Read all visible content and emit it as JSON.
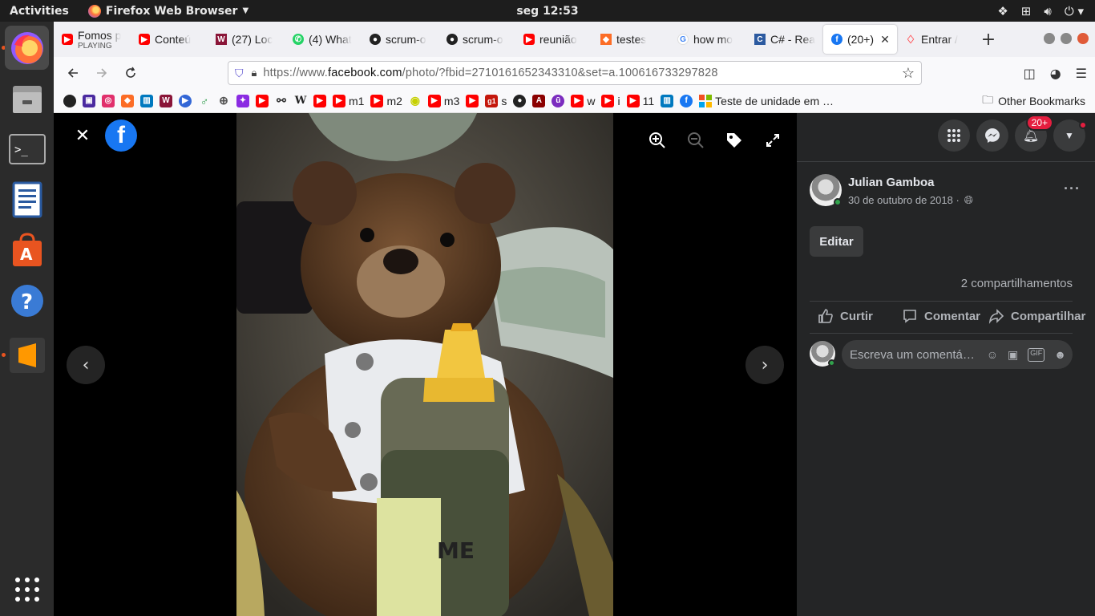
{
  "topbar": {
    "activities": "Activities",
    "app_name": "Firefox Web Browser",
    "clock": "seg 12:53"
  },
  "dock": {
    "items": [
      "firefox-icon",
      "files-icon",
      "terminal-icon",
      "text-editor-icon",
      "software-center-icon",
      "help-icon",
      "sublime-text-icon",
      "show-apps-icon"
    ]
  },
  "tabs": [
    {
      "title": "Fomos p",
      "sub": "PLAYING",
      "icon": "youtube-icon"
    },
    {
      "title": "Conteú",
      "icon": "youtube-icon"
    },
    {
      "title": "(27) Loc",
      "icon": "w-icon"
    },
    {
      "title": "(4) What",
      "icon": "whatsapp-icon"
    },
    {
      "title": "scrum-o",
      "icon": "github-icon"
    },
    {
      "title": "scrum-o",
      "icon": "github-icon"
    },
    {
      "title": "reunião",
      "icon": "youtube-icon"
    },
    {
      "title": "testes",
      "icon": "gitlab-icon"
    },
    {
      "title": "how mo",
      "icon": "google-icon"
    },
    {
      "title": "C# - Rea",
      "icon": "csharp-icon"
    },
    {
      "title": "(20+)",
      "icon": "facebook-icon",
      "active": true
    },
    {
      "title": "Entrar /",
      "icon": "airbnb-icon"
    }
  ],
  "address": {
    "prefix": "https://www.",
    "domain": "facebook.com",
    "path": "/photo/?fbid=2710161652343310&set=a.100616733297828"
  },
  "bookmarks": [
    {
      "icon": "github-icon",
      "label": "",
      "color": "#222"
    },
    {
      "icon": "twitch-icon",
      "label": "",
      "color": "#4b2aa0"
    },
    {
      "icon": "instagram-icon",
      "label": "",
      "color": "#e1306c"
    },
    {
      "icon": "gitlab-icon",
      "label": "",
      "color": "#fc6d26"
    },
    {
      "icon": "trello-icon",
      "label": "",
      "color": "#0079bf"
    },
    {
      "icon": "w-icon",
      "label": "",
      "color": "#8a1538"
    },
    {
      "icon": "play-icon",
      "label": "",
      "color": "#3367d6"
    },
    {
      "icon": "leaf-icon",
      "label": "",
      "color": "#2e9c4a"
    },
    {
      "icon": "globe-icon",
      "label": "",
      "color": "#555"
    },
    {
      "icon": "puzzle-icon",
      "label": "",
      "color": "#8a2be2"
    },
    {
      "icon": "youtube-icon",
      "label": "",
      "color": "#ff0000"
    },
    {
      "icon": "network-icon",
      "label": "",
      "color": "#333"
    },
    {
      "icon": "wikipedia-icon",
      "label": "",
      "color": "#222"
    },
    {
      "icon": "youtube-icon",
      "label": "",
      "color": "#ff0000"
    },
    {
      "icon": "youtube-icon",
      "label": "m1",
      "color": "#ff0000"
    },
    {
      "icon": "youtube-icon",
      "label": "m2",
      "color": "#ff0000"
    },
    {
      "icon": "eye-icon",
      "label": "",
      "color": "#c6d000"
    },
    {
      "icon": "youtube-icon",
      "label": "m3",
      "color": "#ff0000"
    },
    {
      "icon": "youtube-icon",
      "label": "",
      "color": "#ff0000"
    },
    {
      "icon": "g1-icon",
      "label": "s",
      "color": "#c4170c"
    },
    {
      "icon": "github-icon",
      "label": "",
      "color": "#222"
    },
    {
      "icon": "a-icon",
      "label": "",
      "color": "#8b0000"
    },
    {
      "icon": "u-icon",
      "label": "",
      "color": "#7b2cbf"
    },
    {
      "icon": "youtube-icon",
      "label": "w",
      "color": "#ff0000"
    },
    {
      "icon": "youtube-icon",
      "label": "i",
      "color": "#ff0000"
    },
    {
      "icon": "youtube-icon",
      "label": "11",
      "color": "#ff0000"
    },
    {
      "icon": "trello-icon",
      "label": "",
      "color": "#0079bf"
    },
    {
      "icon": "facebook-icon",
      "label": "",
      "color": "#1877f2"
    },
    {
      "icon": "microsoft-icon",
      "label": "Teste de unidade em …",
      "color": "#f25022"
    }
  ],
  "other_bookmarks": "Other Bookmarks",
  "panel": {
    "notification_badge": "20+",
    "author": "Julian Gamboa",
    "date": "30 de outubro de 2018 ·",
    "edit_label": "Editar",
    "shares": "2 compartilhamentos",
    "like": "Curtir",
    "comment": "Comentar",
    "share": "Compartilhar",
    "comment_placeholder": "Escreva um comentá…"
  },
  "colors": {
    "facebook_blue": "#1877f2",
    "panel_bg": "#242526",
    "accent_orange": "#e95420"
  }
}
